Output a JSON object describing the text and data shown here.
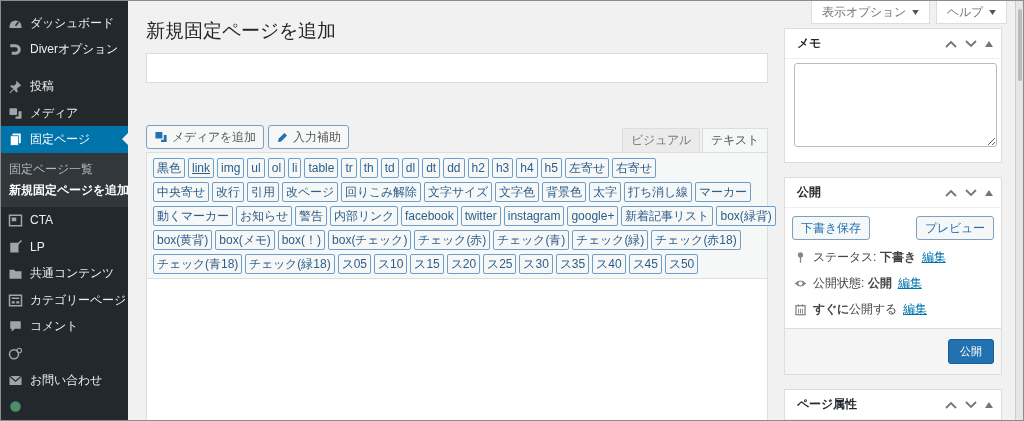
{
  "sidebar": {
    "items": [
      {
        "label": "ダッシュボード",
        "selected": false
      },
      {
        "label": "Diverオプション",
        "selected": false
      },
      {
        "label": "投稿",
        "selected": false
      },
      {
        "label": "メディア",
        "selected": false
      },
      {
        "label": "固定ページ",
        "selected": true,
        "children": [
          {
            "label": "固定ページ一覧",
            "selected": false
          },
          {
            "label": "新規固定ページを追加",
            "selected": true
          }
        ]
      },
      {
        "label": "CTA",
        "selected": false
      },
      {
        "label": "LP",
        "selected": false
      },
      {
        "label": "共通コンテンツ",
        "selected": false
      },
      {
        "label": "カテゴリーページ",
        "selected": false
      },
      {
        "label": "コメント",
        "selected": false
      },
      {
        "selected": false
      },
      {
        "label": "お問い合わせ",
        "selected": false
      },
      {
        "selected": false
      }
    ]
  },
  "screen_meta": [
    "表示オプション",
    "ヘルプ"
  ],
  "page_title": "新規固定ページを追加",
  "editor": {
    "media_buttons": [
      "メディアを追加",
      "入力補助"
    ],
    "tabs": [
      {
        "label": "ビジュアル",
        "selected": false
      },
      {
        "label": "テキスト",
        "selected": true
      }
    ],
    "quicktag_rows": [
      [
        {
          "label": "黒色",
          "kind": "tag"
        },
        {
          "label": "link",
          "kind": "link"
        },
        {
          "label": "img",
          "kind": "tag"
        },
        {
          "label": "ul",
          "kind": "tag"
        },
        {
          "label": "ol",
          "kind": "tag"
        },
        {
          "label": "li",
          "kind": "tag"
        },
        {
          "label": "table",
          "kind": "tag"
        },
        {
          "label": "tr",
          "kind": "tag"
        },
        {
          "label": "th",
          "kind": "tag"
        },
        {
          "label": "td",
          "kind": "tag"
        },
        {
          "label": "dl",
          "kind": "tag"
        },
        {
          "label": "dt",
          "kind": "tag"
        },
        {
          "label": "dd",
          "kind": "tag"
        },
        {
          "label": "h2",
          "kind": "tag"
        },
        {
          "label": "h3",
          "kind": "tag"
        },
        {
          "label": "h4",
          "kind": "tag"
        },
        {
          "label": "h5",
          "kind": "tag"
        },
        {
          "label": "左寄せ",
          "kind": "tag"
        },
        {
          "label": "右寄せ",
          "kind": "tag"
        }
      ],
      [
        {
          "label": "中央寄せ",
          "kind": "tag"
        },
        {
          "label": "改行",
          "kind": "tag"
        },
        {
          "label": "引用",
          "kind": "tag"
        },
        {
          "label": "改ページ",
          "kind": "tag"
        },
        {
          "label": "回りこみ解除",
          "kind": "tag"
        },
        {
          "label": "文字サイズ",
          "kind": "tag"
        },
        {
          "label": "文字色",
          "kind": "tag"
        },
        {
          "label": "背景色",
          "kind": "tag"
        },
        {
          "label": "太字",
          "kind": "tag"
        },
        {
          "label": "打ち消し線",
          "kind": "tag"
        },
        {
          "label": "マーカー",
          "kind": "tag"
        }
      ],
      [
        {
          "label": "動くマーカー",
          "kind": "tag"
        },
        {
          "label": "お知らせ",
          "kind": "tag"
        },
        {
          "label": "警告",
          "kind": "tag"
        },
        {
          "label": "内部リンク",
          "kind": "tag"
        },
        {
          "label": "facebook",
          "kind": "tag"
        },
        {
          "label": "twitter",
          "kind": "tag"
        },
        {
          "label": "instagram",
          "kind": "tag"
        },
        {
          "label": "google+",
          "kind": "tag"
        },
        {
          "label": "新着記事リスト",
          "kind": "tag"
        },
        {
          "label": "box(緑背)",
          "kind": "tag"
        }
      ],
      [
        {
          "label": "box(黄背)",
          "kind": "tag"
        },
        {
          "label": "box(メモ)",
          "kind": "tag"
        },
        {
          "label": "box(！)",
          "kind": "tag"
        },
        {
          "label": "box(チェック)",
          "kind": "tag"
        },
        {
          "label": "チェック(赤)",
          "kind": "tag"
        },
        {
          "label": "チェック(青)",
          "kind": "tag"
        },
        {
          "label": "チェック(緑)",
          "kind": "tag"
        },
        {
          "label": "チェック(赤18)",
          "kind": "tag"
        }
      ],
      [
        {
          "label": "チェック(青18)",
          "kind": "tag"
        },
        {
          "label": "チェック(緑18)",
          "kind": "tag"
        },
        {
          "label": "ス05",
          "kind": "tag"
        },
        {
          "label": "ス10",
          "kind": "tag"
        },
        {
          "label": "ス15",
          "kind": "tag"
        },
        {
          "label": "ス20",
          "kind": "tag"
        },
        {
          "label": "ス25",
          "kind": "tag"
        },
        {
          "label": "ス30",
          "kind": "tag"
        },
        {
          "label": "ス35",
          "kind": "tag"
        },
        {
          "label": "ス40",
          "kind": "tag"
        },
        {
          "label": "ス45",
          "kind": "tag"
        },
        {
          "label": "ス50",
          "kind": "tag"
        }
      ]
    ]
  },
  "memo_box": {
    "title": "メモ"
  },
  "publish_box": {
    "title": "公開",
    "save_draft": "下書き保存",
    "preview": "プレビュー",
    "rows": [
      {
        "text": "ステータス: **下書き**",
        "link": "編集"
      },
      {
        "text": "公開状態: **公開**",
        "link": "編集"
      },
      {
        "text": "**すぐに**公開する",
        "link": "編集"
      }
    ],
    "publish": "公開"
  },
  "attributes_box": {
    "title": "ページ属性"
  }
}
